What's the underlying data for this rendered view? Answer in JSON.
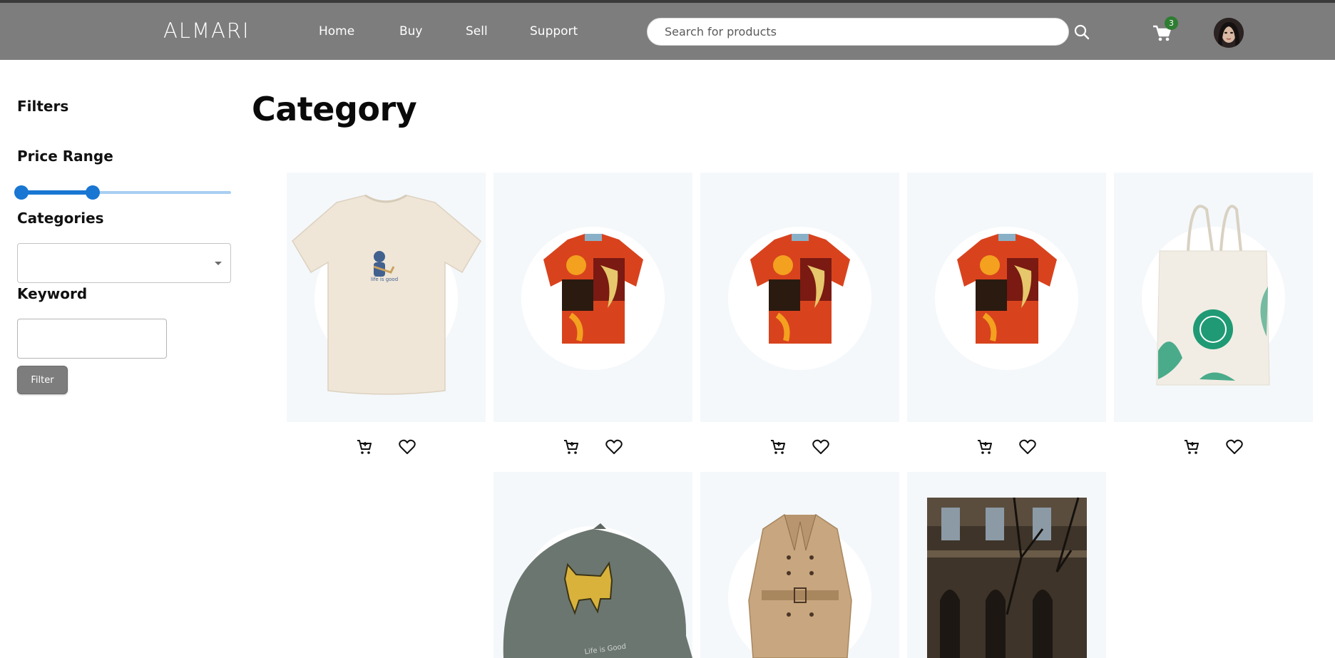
{
  "header": {
    "logo": "ALMARI",
    "nav": [
      {
        "label": "Home"
      },
      {
        "label": "Buy"
      },
      {
        "label": "Sell"
      },
      {
        "label": "Support"
      }
    ],
    "search_placeholder": "Search for products",
    "cart_count": "3",
    "icons": {
      "search": "search-icon",
      "cart": "shopping-cart-icon",
      "avatar": "user-avatar"
    }
  },
  "sidebar": {
    "title": "Filters",
    "price_range": {
      "label": "Price Range",
      "low_fraction": 0.0,
      "high_fraction": 0.34
    },
    "categories": {
      "label": "Categories",
      "selected": ""
    },
    "keyword": {
      "label": "Keyword",
      "value": ""
    },
    "filter_button": "Filter"
  },
  "main": {
    "title": "Category",
    "products": [
      {
        "type": "t-shirt",
        "colors": {
          "primary": "#efe6d8",
          "accent": "#3b5b8c"
        }
      },
      {
        "type": "hawaiian-shirt",
        "colors": {
          "primary": "#d8431e",
          "accent": "#7a1a12"
        }
      },
      {
        "type": "hawaiian-shirt",
        "colors": {
          "primary": "#d8431e",
          "accent": "#7a1a12"
        }
      },
      {
        "type": "hawaiian-shirt",
        "colors": {
          "primary": "#d8431e",
          "accent": "#7a1a12"
        }
      },
      {
        "type": "tote-bag",
        "colors": {
          "primary": "#f2ede4",
          "accent": "#1f9a74"
        }
      },
      {
        "type": "cap",
        "colors": {
          "primary": "#6c7670",
          "accent": "#d9b23c"
        }
      },
      {
        "type": "trench-coat",
        "colors": {
          "primary": "#c8a67f",
          "accent": "#8a6c4c"
        }
      },
      {
        "type": "building-photo",
        "colors": {
          "primary": "#3e3429",
          "accent": "#1c1712"
        }
      }
    ],
    "card_icons": {
      "cart": "add-to-cart-icon",
      "wishlist": "heart-icon"
    }
  },
  "colors": {
    "navbar": "#7d7d7d",
    "accent_blue": "#1976d2",
    "badge_green": "#2e7d32",
    "card_bg": "#f4f8fb"
  }
}
